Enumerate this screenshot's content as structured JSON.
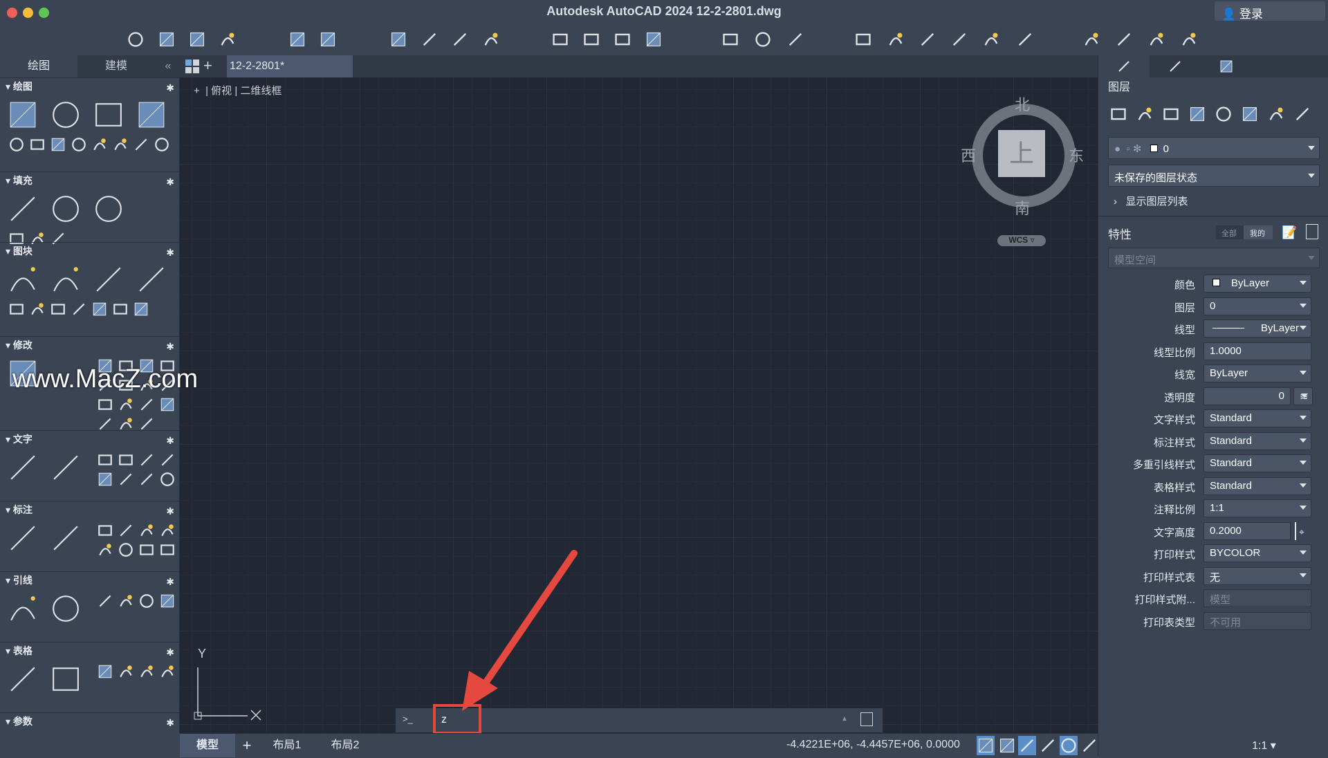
{
  "window": {
    "title": "Autodesk AutoCAD 2024   12-2-2801.dwg",
    "login": "登录"
  },
  "toolbar": {
    "icons": [
      "new-icon",
      "open-icon",
      "save-icon",
      "save-as-icon",
      "undo-icon",
      "redo-icon",
      "plot-icon",
      "batch-plot-icon",
      "page-setup-icon",
      "publish-icon",
      "import-icon",
      "export-icon",
      "attach-icon",
      "etransmit-icon",
      "zoom-window-icon",
      "pan-icon",
      "orbit-icon",
      "match-properties-icon",
      "quick-select-icon",
      "layer-icon",
      "group-icon",
      "measure-icon",
      "calculator-icon",
      "palette-icon",
      "share-icon",
      "presentation-icon",
      "notification-icon"
    ]
  },
  "left_tabs": [
    "绘图",
    "建模"
  ],
  "collapse_label": "«",
  "doc_tab": "12-2-2801*",
  "viewport_label": {
    "plus": "+",
    "view": "俯视",
    "style": "二维线框"
  },
  "sections": [
    {
      "title": "绘图",
      "large": [
        "line-icon",
        "polyline-icon",
        "circle-icon",
        "rectangle-icon"
      ],
      "small": [
        "arc-icon",
        "spline-icon",
        "multiline-icon",
        "ray-icon",
        "ellipse-icon",
        "polygon-icon",
        "xline-icon",
        "revcloud-icon"
      ]
    },
    {
      "title": "填充",
      "large": [
        "hatch-icon",
        "gradient-icon",
        "boundary-icon"
      ],
      "small": [
        "region-icon",
        "wipeout-icon",
        "table-fill-icon"
      ]
    },
    {
      "title": "图块",
      "large": [
        "create-block-icon",
        "insert-block-icon",
        "edit-block-icon",
        "block-attribute-icon"
      ],
      "small": [
        "define-attribute-icon",
        "block-editor-icon",
        "write-block-icon",
        "base-point-icon",
        "sync-attribute-icon",
        "manage-attribute-icon",
        "edit-attribute-icon"
      ]
    },
    {
      "title": "修改",
      "large": [
        "move-icon"
      ],
      "small": [
        "copy-icon",
        "rotate-icon",
        "trim-icon",
        "fillet-icon",
        "array-icon",
        "mirror-icon",
        "stretch-icon",
        "scale-icon",
        "offset-icon",
        "explode-icon",
        "align-icon",
        "join-icon",
        "break-icon",
        "chamfer-icon",
        "erase-icon"
      ]
    },
    {
      "title": "文字",
      "large": [
        "mtext-icon",
        "text-style-icon"
      ],
      "small": [
        "single-text-icon",
        "spell-check-icon",
        "table-text-icon",
        "pdf-import-icon",
        "find-text-icon",
        "field-icon",
        "scale-text-icon",
        "pdf-text-icon"
      ]
    },
    {
      "title": "标注",
      "large": [
        "linear-dim-icon",
        "leader-dim-icon"
      ],
      "small": [
        "aligned-dim-icon",
        "radius-dim-icon",
        "baseline-dim-icon",
        "ordinate-dim-icon",
        "continue-dim-icon",
        "tolerance-dim-icon",
        "center-mark-icon",
        "oblique-dim-icon"
      ]
    },
    {
      "title": "引线",
      "large": [
        "mleader-icon",
        "mleader-style-icon"
      ],
      "small": [
        "add-leader-icon",
        "align-leader-icon",
        "remove-leader-icon",
        "collect-leader-icon"
      ]
    },
    {
      "title": "表格",
      "large": [
        "table-icon",
        "table-style-icon"
      ],
      "small": [
        "data-link-icon",
        "data-extract-icon",
        "table-export-icon",
        "table-update-icon"
      ]
    },
    {
      "title": "参数",
      "large": [],
      "small": []
    }
  ],
  "watermark": "www.MacZ.com",
  "viewcube": {
    "north": "北",
    "south": "南",
    "west": "西",
    "east": "东",
    "top": "上",
    "wcs": "WCS"
  },
  "ucs": {
    "y": "Y"
  },
  "command": {
    "prompt": ">_",
    "value": "z"
  },
  "status": {
    "tabs": [
      "模型",
      "布局1",
      "布局2"
    ],
    "add": "+",
    "coords": "-4.4221E+06, -4.4457E+06, 0.0000",
    "scale": "1:1",
    "buttons": [
      {
        "name": "grid-icon",
        "on": true
      },
      {
        "name": "snap-icon",
        "on": false
      },
      {
        "name": "ortho-icon",
        "on": true
      },
      {
        "name": "polar-icon",
        "on": false
      },
      {
        "name": "isodraft-icon",
        "on": true
      },
      {
        "name": "lineweight-icon",
        "on": false
      },
      {
        "name": "transparency-icon",
        "on": true
      },
      {
        "name": "selection-cycling-icon",
        "on": true
      },
      {
        "name": "dynamic-ucs-icon",
        "on": true
      },
      {
        "name": "object-snap-icon",
        "on": true
      },
      {
        "name": "annotation-visibility-icon",
        "on": true
      },
      {
        "name": "auto-scale-icon",
        "on": false
      },
      {
        "name": "annotation-scale-icon",
        "on": false
      }
    ]
  },
  "accent": "#5b8fc9",
  "highlight": "#e5483e",
  "layers": {
    "title": "图层",
    "current_layer": "0",
    "state": "未保存的图层状态",
    "show_list": "显示图层列表",
    "icons": [
      "layer-properties-icon",
      "make-current-icon",
      "match-layer-icon",
      "layer-previous-icon",
      "layer-isolate-icon",
      "layer-off-icon",
      "layer-freeze-icon",
      "layer-lock-icon"
    ]
  },
  "properties": {
    "title": "特性",
    "toggle": [
      "全部",
      "我的"
    ],
    "space": "模型空间",
    "rows": [
      {
        "label": "颜色",
        "value": "ByLayer",
        "type": "swatch"
      },
      {
        "label": "图层",
        "value": "0",
        "type": "dropdown"
      },
      {
        "label": "线型",
        "value": "ByLayer",
        "type": "linetype"
      },
      {
        "label": "线型比例",
        "value": "1.0000",
        "type": "text"
      },
      {
        "label": "线宽",
        "value": "ByLayer",
        "type": "dropdown"
      },
      {
        "label": "透明度",
        "value": "0",
        "type": "slider"
      },
      {
        "label": "文字样式",
        "value": "Standard",
        "type": "dropdown"
      },
      {
        "label": "标注样式",
        "value": "Standard",
        "type": "dropdown"
      },
      {
        "label": "多重引线样式",
        "value": "Standard",
        "type": "dropdown"
      },
      {
        "label": "表格样式",
        "value": "Standard",
        "type": "dropdown"
      },
      {
        "label": "注释比例",
        "value": "1:1",
        "type": "dropdown"
      },
      {
        "label": "文字高度",
        "value": "0.2000",
        "type": "textpick"
      },
      {
        "label": "打印样式",
        "value": "BYCOLOR",
        "type": "dropdown"
      },
      {
        "label": "打印样式表",
        "value": "无",
        "type": "dropdown"
      },
      {
        "label": "打印样式附...",
        "value": "模型",
        "type": "disabled"
      },
      {
        "label": "打印表类型",
        "value": "不可用",
        "type": "disabled"
      }
    ]
  }
}
